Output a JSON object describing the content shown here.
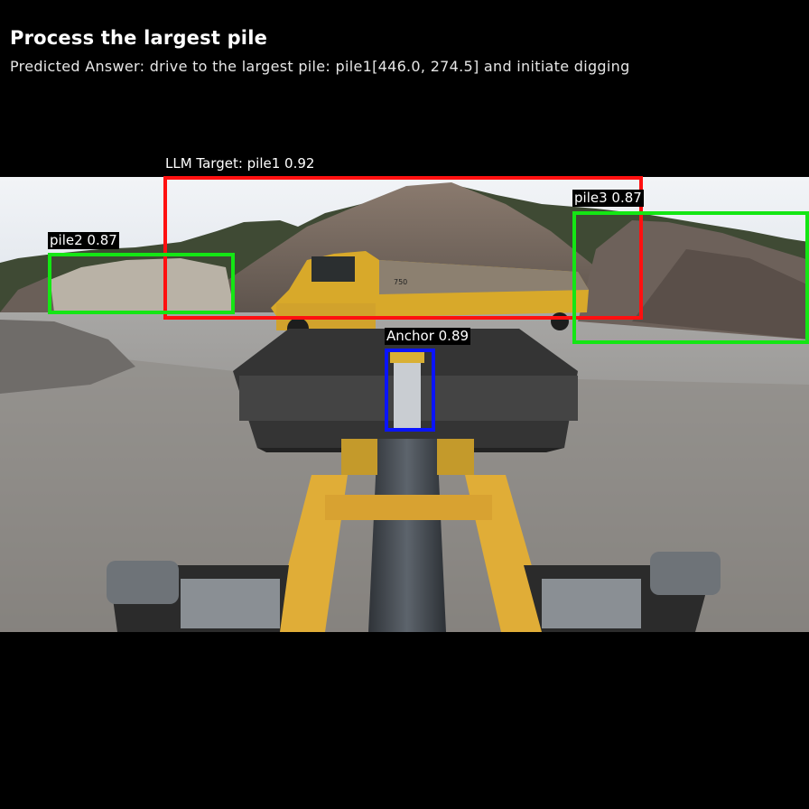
{
  "header": {
    "title": "Process the largest pile",
    "predicted_answer": "Predicted Answer: drive to the largest pile: pile1[446.0, 274.5] and initiate digging"
  },
  "detections": {
    "llm_target": {
      "label": "LLM Target: pile1 0.92",
      "color": "#ff1010"
    },
    "pile2": {
      "label": "pile2 0.87",
      "color": "#14e614"
    },
    "pile3": {
      "label": "pile3 0.87",
      "color": "#14e614"
    },
    "anchor": {
      "label": "Anchor 0.89",
      "color": "#0a14ff"
    }
  },
  "scene": {
    "icon": "wheel-loader-cab-view-photo",
    "truck_text": "750"
  }
}
